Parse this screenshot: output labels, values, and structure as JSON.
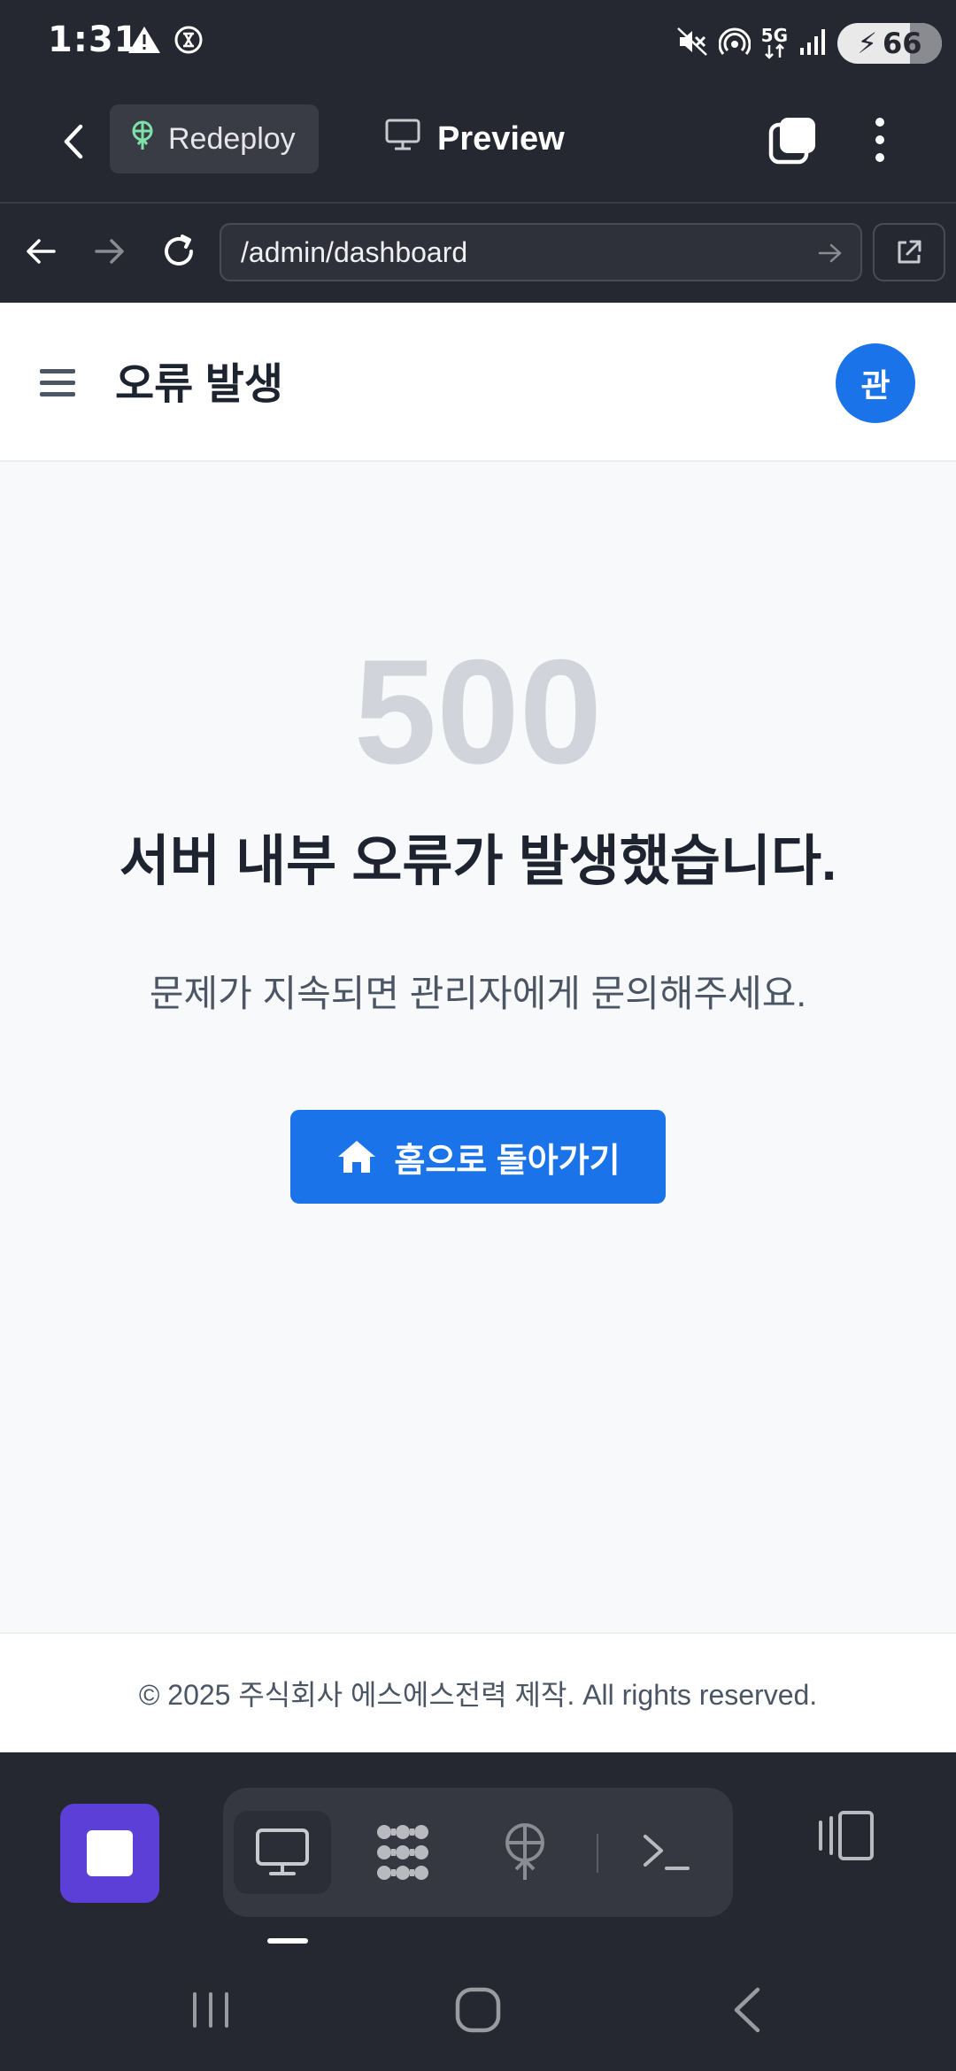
{
  "status_bar": {
    "time": "1:31",
    "battery_level": "66",
    "network": "5G",
    "icons": [
      "warning-icon",
      "data-saver-icon",
      "mute-icon",
      "hotspot-icon",
      "signal-icon",
      "battery-charging-icon"
    ]
  },
  "app_toolbar": {
    "redeploy_label": "Redeploy",
    "preview_label": "Preview",
    "accent_color": "#7ee2a8"
  },
  "url_bar": {
    "url": "/admin/dashboard"
  },
  "page": {
    "title": "오류 발생",
    "avatar_initial": "관",
    "error_code": "500",
    "error_title": "서버 내부 오류가 발생했습니다.",
    "error_description": "문제가 지속되면 관리자에게 문의해주세요.",
    "home_button_label": "홈으로 돌아가기",
    "footer_text": "© 2025 주식회사 에스에스전력 제작. All rights reserved.",
    "primary_color": "#1a73e8"
  },
  "bottom_dock": {
    "items": [
      "preview-icon",
      "agent-icon",
      "deploy-icon",
      "terminal-icon"
    ],
    "stop_color": "#5b3fd6"
  }
}
